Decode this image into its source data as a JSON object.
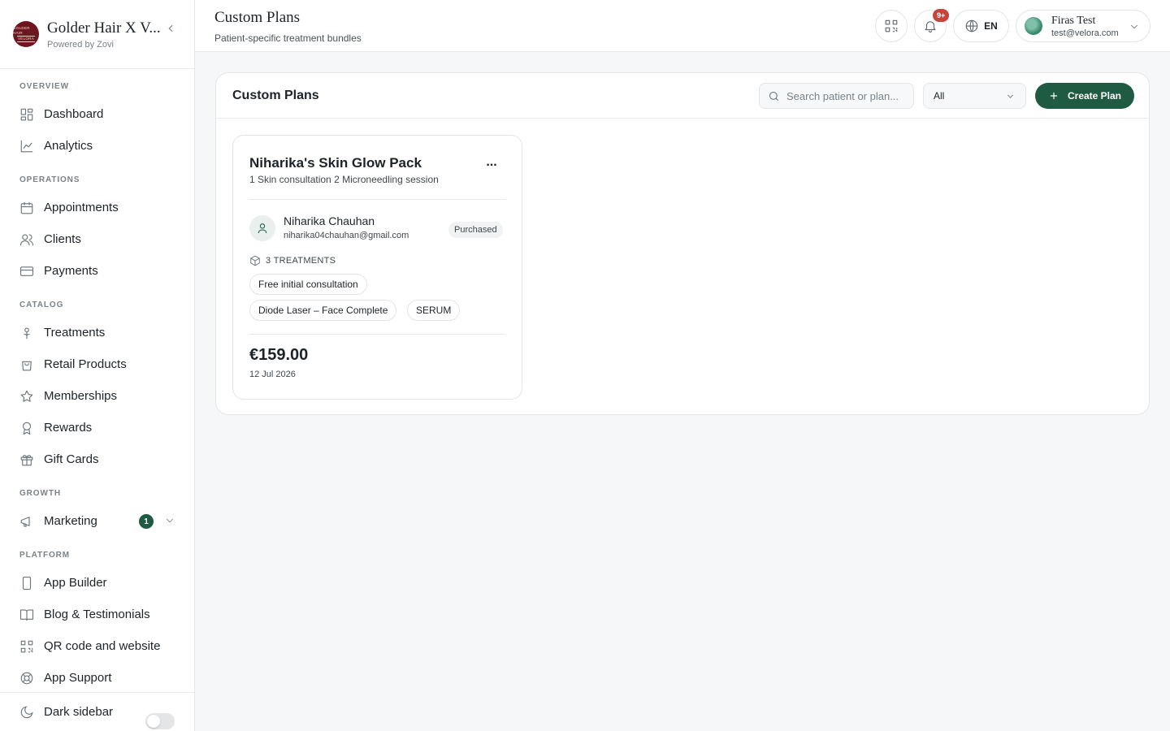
{
  "brand": {
    "logo_top": "GOLDER HAIR",
    "logo_mid": "VELORA",
    "name": "Golder Hair X V...",
    "powered_by": "Powered by Zovi"
  },
  "sidebar": {
    "sections": [
      {
        "title": "OVERVIEW",
        "items": [
          {
            "label": "Dashboard",
            "icon": "dashboard-icon"
          },
          {
            "label": "Analytics",
            "icon": "chart-line-icon"
          }
        ]
      },
      {
        "title": "OPERATIONS",
        "items": [
          {
            "label": "Appointments",
            "icon": "calendar-icon"
          },
          {
            "label": "Clients",
            "icon": "users-icon"
          },
          {
            "label": "Payments",
            "icon": "credit-card-icon"
          }
        ]
      },
      {
        "title": "CATALOG",
        "items": [
          {
            "label": "Treatments",
            "icon": "flower-icon"
          },
          {
            "label": "Retail Products",
            "icon": "shopping-bag-icon"
          },
          {
            "label": "Memberships",
            "icon": "star-icon"
          },
          {
            "label": "Rewards",
            "icon": "award-icon"
          },
          {
            "label": "Gift Cards",
            "icon": "gift-icon"
          }
        ]
      },
      {
        "title": "GROWTH",
        "items": [
          {
            "label": "Marketing",
            "icon": "megaphone-icon",
            "badge": "1"
          }
        ]
      },
      {
        "title": "PLATFORM",
        "items": [
          {
            "label": "App Builder",
            "icon": "smartphone-icon"
          },
          {
            "label": "Blog & Testimonials",
            "icon": "book-open-icon"
          },
          {
            "label": "QR code and website",
            "icon": "qr-code-icon"
          },
          {
            "label": "App Support",
            "icon": "life-buoy-icon"
          }
        ]
      }
    ],
    "footer": {
      "label": "Dark sidebar",
      "toggle_on": false
    }
  },
  "header": {
    "title": "Custom Plans",
    "subtitle": "Patient-specific treatment bundles",
    "notifications_badge": "9+",
    "language": "EN",
    "user": {
      "name": "Firas Test",
      "email": "test@velora.com"
    }
  },
  "main": {
    "panel_title": "Custom Plans",
    "search_placeholder": "Search patient or plan...",
    "filter_value": "All",
    "create_button": "Create Plan",
    "accent_color": "#1f5b43",
    "plans": [
      {
        "title": "Niharika's Skin Glow Pack",
        "description": "1 Skin consultation 2 Microneedling session",
        "more": "...",
        "patient_name": "Niharika Chauhan",
        "patient_email": "niharika04chauhan@gmail.com",
        "status": "Purchased",
        "treatments_label": "3 TREATMENTS",
        "treatments": [
          "Free initial consultation",
          "Diode Laser – Face Complete",
          "SERUM"
        ],
        "price": "€159.00",
        "date": "12 Jul 2026"
      }
    ]
  }
}
